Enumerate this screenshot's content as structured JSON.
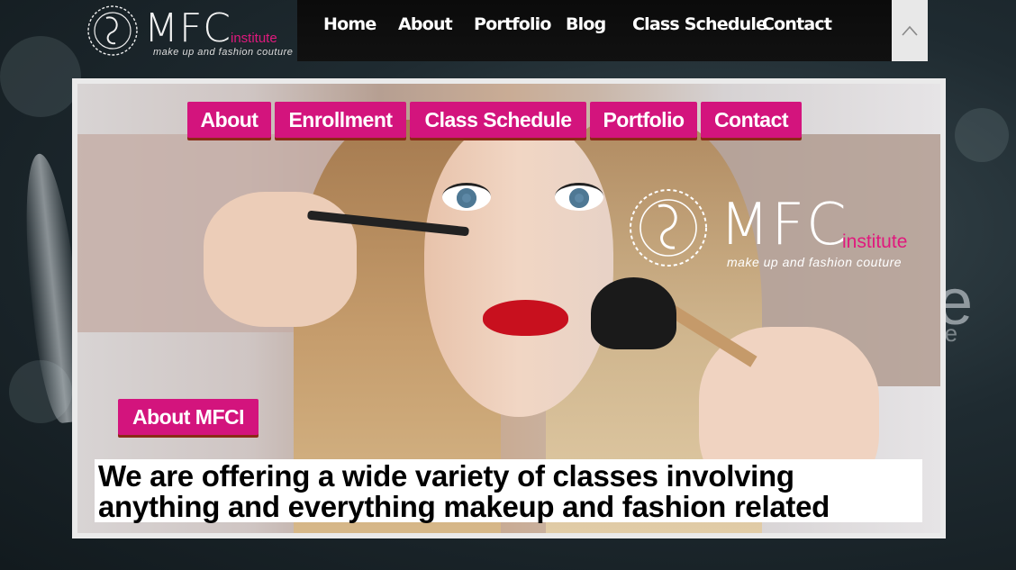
{
  "brand": {
    "mf": "MFC",
    "institute": "institute",
    "tagline": "make up and fashion couture"
  },
  "topnav": {
    "items": [
      "Home",
      "About",
      "Portfolio",
      "Blog",
      "Class Schedule",
      "Contact"
    ],
    "scroll_top_icon": "chevron-up-icon"
  },
  "hero": {
    "nav": [
      "About",
      "Enrollment",
      "Class Schedule",
      "Portfolio",
      "Contact"
    ],
    "about_button": "About MFCI",
    "caption_line1": "We are offering a wide variety of classes involving",
    "caption_line2": "anything and everything makeup and fashion related"
  },
  "background": {
    "letter1": "e",
    "letter2": "re"
  },
  "colors": {
    "accent": "#d3147d",
    "institute_pink": "#e0197d",
    "nav_bg": "#0b0b0b"
  }
}
